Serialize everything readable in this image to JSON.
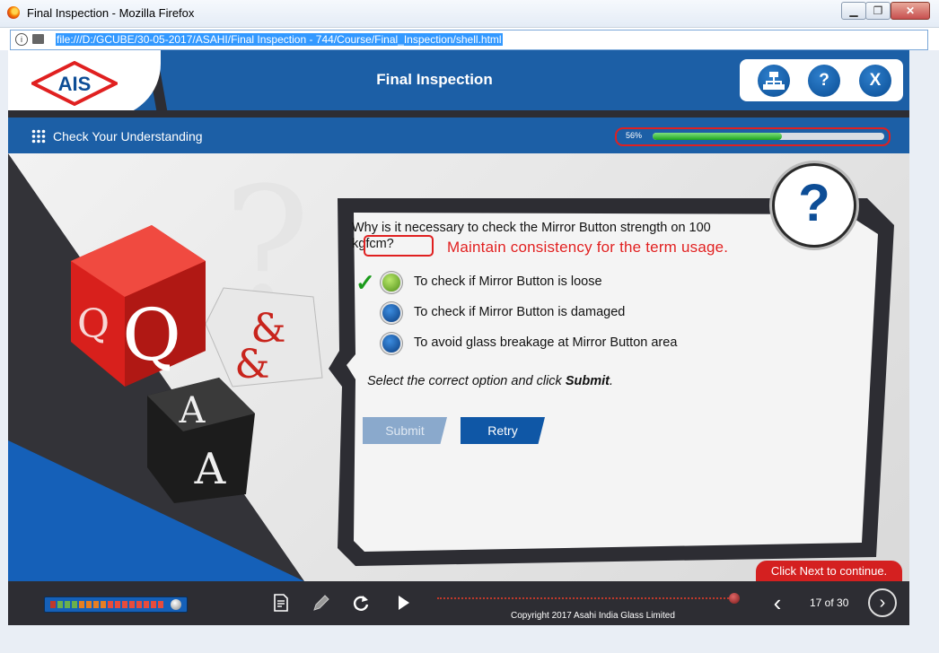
{
  "window": {
    "title": "Final Inspection - Mozilla Firefox",
    "minimize": "▁",
    "maximize": "❐",
    "close": "✕"
  },
  "urlbar": {
    "info": "i",
    "url": "file:///D:/GCUBE/30-05-2017/ASAHI/Final Inspection - 744/Course/Final_Inspection/shell.html"
  },
  "header": {
    "logo_text": "AIS",
    "course_title": "Final Inspection",
    "tools": {
      "sitemap_icon": "sitemap-icon",
      "help_label": "?",
      "exit_label": "X"
    }
  },
  "subheader": {
    "section_title": "Check Your Understanding",
    "progress_label": "56%",
    "progress_value": 0.56
  },
  "question": {
    "text": "Why is it necessary to check the Mirror Button strength on 100 kgfcm?",
    "review_note": "Maintain consistency for the term usage.",
    "badge": "?",
    "options": [
      {
        "label": "To check if Mirror Button is loose",
        "state": "correct"
      },
      {
        "label": "To check if Mirror Button is damaged",
        "state": "default"
      },
      {
        "label": "To avoid glass breakage at Mirror Button area",
        "state": "default"
      }
    ],
    "correct_mark": "✓",
    "instruction_prefix": "Select the correct option and click ",
    "instruction_action": "Submit",
    "instruction_suffix": ".",
    "submit_label": "Submit",
    "retry_label": "Retry"
  },
  "next_hint": "Click Next to continue.",
  "footer": {
    "copyright": "Copyright 2017 Asahi India Glass Limited",
    "page_counter": "17 of 30",
    "prev": "‹",
    "next": "›",
    "icons": [
      "transcript-icon",
      "notes-icon",
      "replay-icon",
      "play-icon"
    ]
  },
  "colors": {
    "brand_blue": "#1c5fa6",
    "dark": "#2d2d33",
    "accent_red": "#e02020",
    "correct_green": "#1a9a1a"
  }
}
